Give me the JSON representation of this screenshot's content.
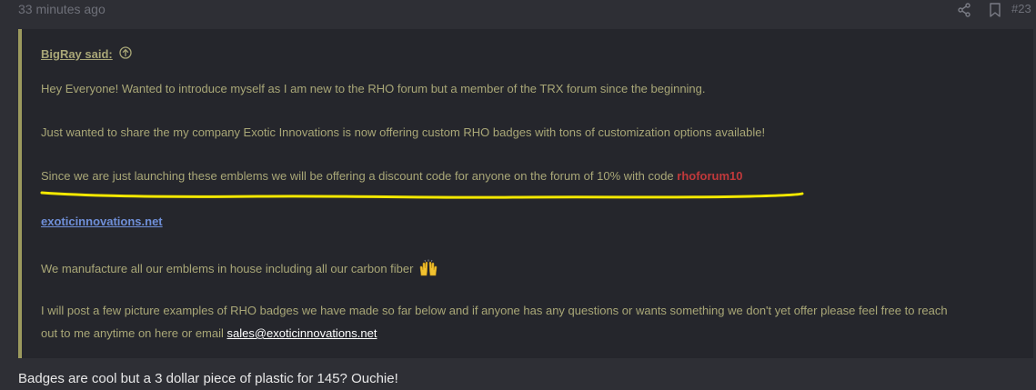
{
  "post": {
    "time_ago": "33 minutes ago",
    "post_number": "#23"
  },
  "quote": {
    "author": "BigRay said:",
    "line1": "Hey Everyone! Wanted to introduce myself as I am new to the RHO forum but a member of the TRX forum since the beginning.",
    "line2": "Just wanted to share the my company Exotic Innovations is now offering custom RHO badges with tons of customization options available!",
    "line3_text": "Since we are just launching these emblems we will be offering a discount code for anyone on the forum of 10% with code ",
    "line3_code": "rhoforum10",
    "link": "exoticinnovations.net",
    "line5": "We manufacture all our emblems in house including all our carbon fiber",
    "line6": "I will post a few picture examples of RHO badges we have made so far below and if anyone has any questions or wants something we don't yet offer please feel free to reach",
    "line7_text": "out to me anytime on here or email ",
    "email": "sales@exoticinnovations.net"
  },
  "reply": {
    "text": "Badges are cool but a 3 dollar piece of plastic for 145? Ouchie!"
  },
  "colors": {
    "background": "#2e2f35",
    "quote_background": "#25262c",
    "quote_border": "#9c9a5e",
    "quote_text": "#a9a777",
    "promo_code": "#c0393b",
    "link": "#6f8fd8",
    "highlight_stroke": "#f3e800"
  },
  "icons": [
    "share-icon",
    "bookmark-icon",
    "arrow-up-circle-icon",
    "raised-hands-emoji"
  ]
}
